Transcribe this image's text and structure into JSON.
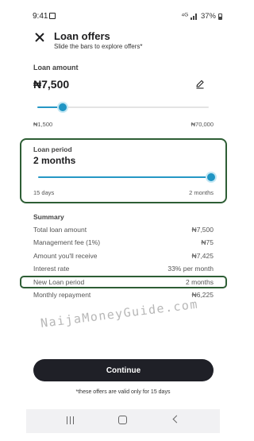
{
  "status_bar": {
    "time": "9:41",
    "network": "⁴ᴳ",
    "battery": "37%"
  },
  "header": {
    "title": "Loan offers",
    "subtitle": "Slide the bars to explore offers*"
  },
  "loan_amount": {
    "label": "Loan amount",
    "value": "₦7,500",
    "min_label": "₦1,500",
    "max_label": "₦70,000",
    "slider_fraction": 0.15
  },
  "loan_period": {
    "label": "Loan period",
    "value": "2 months",
    "min_label": "15 days",
    "max_label": "2 months",
    "slider_fraction": 1.0
  },
  "summary": {
    "title": "Summary",
    "rows": [
      {
        "label": "Total loan amount",
        "value": "₦7,500"
      },
      {
        "label": "Management fee (1%)",
        "value": "₦75"
      },
      {
        "label": "Amount you'll receive",
        "value": "₦7,425"
      },
      {
        "label": "Interest rate",
        "value": "33% per month"
      },
      {
        "label": "New Loan period",
        "value": "2 months"
      },
      {
        "label": "Monthly repayment",
        "value": "₦6,225"
      }
    ]
  },
  "watermark": "NaijaMoneyGuide.com",
  "continue_label": "Continue",
  "footnote": "*these offers are valid only for 15 days",
  "colors": {
    "accent": "#1f95c4",
    "button": "#1f2027",
    "highlight_border": "#2e5e35"
  },
  "icons": {
    "close": "close-icon",
    "edit": "edit-icon",
    "nav_recent": "recent-apps-icon",
    "nav_home": "home-icon",
    "nav_back": "back-icon"
  }
}
